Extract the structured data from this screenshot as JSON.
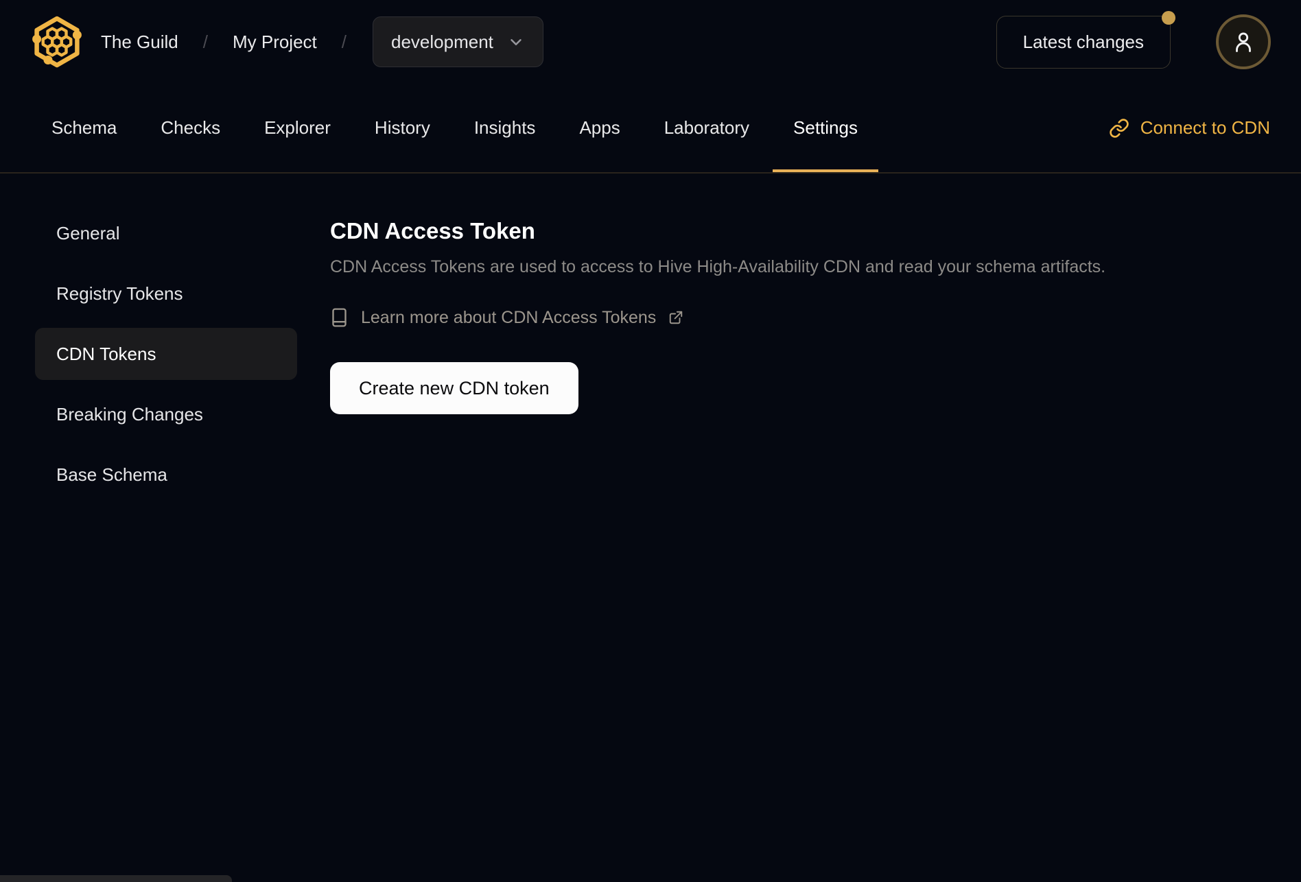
{
  "header": {
    "breadcrumb": [
      {
        "label": "The Guild"
      },
      {
        "label": "My Project"
      }
    ],
    "separator": "/",
    "env_selector": {
      "value": "development"
    },
    "latest_changes_label": "Latest changes",
    "notification_dot": true
  },
  "tabbar": {
    "items": [
      {
        "label": "Schema",
        "active": false
      },
      {
        "label": "Checks",
        "active": false
      },
      {
        "label": "Explorer",
        "active": false
      },
      {
        "label": "History",
        "active": false
      },
      {
        "label": "Insights",
        "active": false
      },
      {
        "label": "Apps",
        "active": false
      },
      {
        "label": "Laboratory",
        "active": false
      },
      {
        "label": "Settings",
        "active": true
      }
    ],
    "connect_label": "Connect to CDN"
  },
  "sidebar": {
    "items": [
      {
        "label": "General",
        "active": false
      },
      {
        "label": "Registry Tokens",
        "active": false
      },
      {
        "label": "CDN Tokens",
        "active": true
      },
      {
        "label": "Breaking Changes",
        "active": false
      },
      {
        "label": "Base Schema",
        "active": false
      }
    ]
  },
  "main": {
    "title": "CDN Access Token",
    "description": "CDN Access Tokens are used to access to Hive High-Availability CDN and read your schema artifacts.",
    "learn_more_label": "Learn more about CDN Access Tokens",
    "create_button_label": "Create new CDN token"
  },
  "icons": {
    "logo": "guild-hexagon-honeycomb-logo",
    "env_chevron": "chevron-down",
    "user": "user-avatar",
    "connect": "link-chain",
    "learn_more": "book",
    "external": "external-link"
  },
  "colors": {
    "background": "#050811",
    "accent_gold": "#f0b545",
    "tab_underline": "#e8b158",
    "notification_dot": "#c79e4e",
    "avatar_ring": "#6d5a35",
    "active_item_bg": "#1b1b1d",
    "muted_text": "#8d8b88",
    "button_bg": "#fcfcfc"
  }
}
